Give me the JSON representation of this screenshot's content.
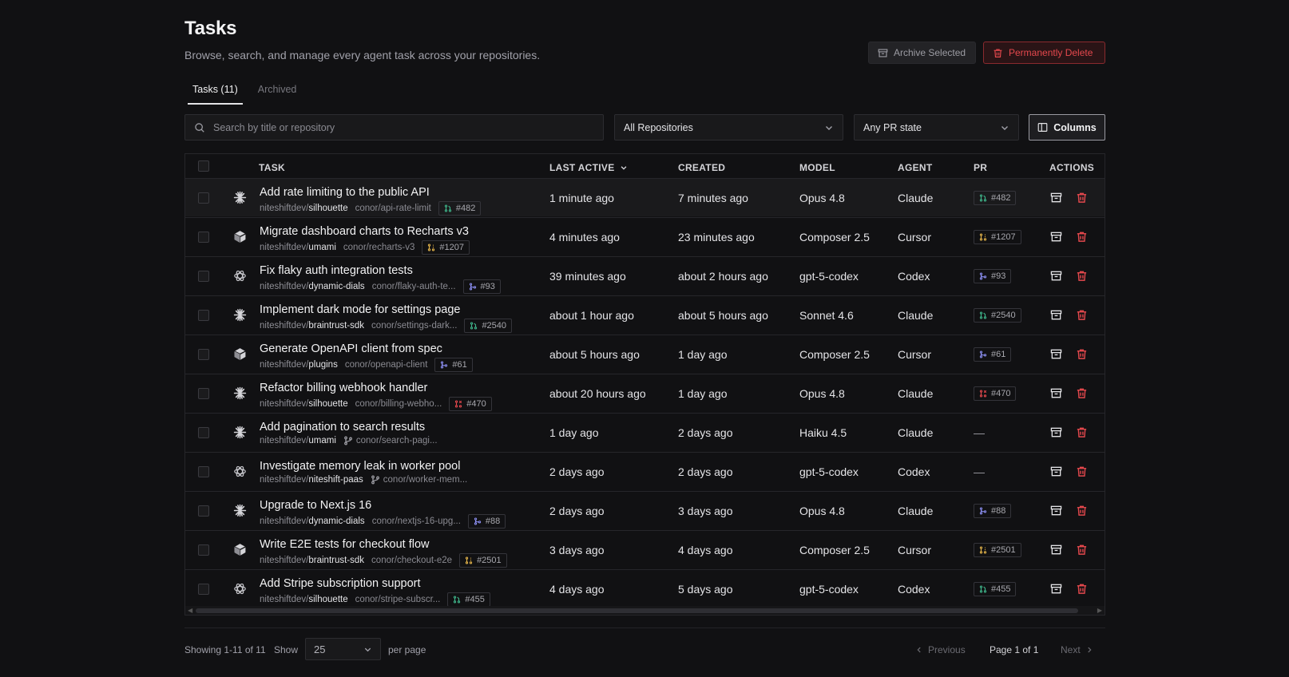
{
  "header": {
    "title": "Tasks",
    "subtitle": "Browse, search, and manage every agent task across your repositories.",
    "archive_selected": "Archive Selected",
    "permanently_delete": "Permanently Delete"
  },
  "tabs": [
    {
      "label": "Tasks (11)",
      "active": true
    },
    {
      "label": "Archived",
      "active": false
    }
  ],
  "filters": {
    "search_placeholder": "Search by title or repository",
    "search_value": "",
    "repository": "All Repositories",
    "pr_state": "Any PR state",
    "columns": "Columns"
  },
  "table": {
    "headers": {
      "task": "TASK",
      "last_active": "LAST ACTIVE",
      "created": "CREATED",
      "model": "MODEL",
      "agent": "AGENT",
      "pr": "PR",
      "actions": "ACTIONS"
    },
    "rows": [
      {
        "icon": "claude-icon",
        "title": "Add rate limiting to the public API",
        "owner": "niteshiftdev/",
        "repo": "silhouette",
        "branch": "conor/api-rate-limit",
        "pr": "#482",
        "pr_state": "open",
        "last_active": "1 minute ago",
        "created": "7 minutes ago",
        "model": "Opus 4.8",
        "agent": "Claude"
      },
      {
        "icon": "cursor-icon",
        "title": "Migrate dashboard charts to Recharts v3",
        "owner": "niteshiftdev/",
        "repo": "umami",
        "branch": "conor/recharts-v3",
        "pr": "#1207",
        "pr_state": "draft",
        "last_active": "4 minutes ago",
        "created": "23 minutes ago",
        "model": "Composer 2.5",
        "agent": "Cursor"
      },
      {
        "icon": "codex-icon",
        "title": "Fix flaky auth integration tests",
        "owner": "niteshiftdev/",
        "repo": "dynamic-dials",
        "branch": "conor/flaky-auth-te...",
        "pr": "#93",
        "pr_state": "merged",
        "last_active": "39 minutes ago",
        "created": "about 2 hours ago",
        "model": "gpt-5-codex",
        "agent": "Codex"
      },
      {
        "icon": "claude-icon",
        "title": "Implement dark mode for settings page",
        "owner": "niteshiftdev/",
        "repo": "braintrust-sdk",
        "branch": "conor/settings-dark...",
        "pr": "#2540",
        "pr_state": "open",
        "last_active": "about 1 hour ago",
        "created": "about 5 hours ago",
        "model": "Sonnet 4.6",
        "agent": "Claude"
      },
      {
        "icon": "cursor-icon",
        "title": "Generate OpenAPI client from spec",
        "owner": "niteshiftdev/",
        "repo": "plugins",
        "branch": "conor/openapi-client",
        "pr": "#61",
        "pr_state": "merged",
        "last_active": "about 5 hours ago",
        "created": "1 day ago",
        "model": "Composer 2.5",
        "agent": "Cursor"
      },
      {
        "icon": "claude-icon",
        "title": "Refactor billing webhook handler",
        "owner": "niteshiftdev/",
        "repo": "silhouette",
        "branch": "conor/billing-webho...",
        "pr": "#470",
        "pr_state": "closed",
        "last_active": "about 20 hours ago",
        "created": "1 day ago",
        "model": "Opus 4.8",
        "agent": "Claude"
      },
      {
        "icon": "claude-icon",
        "title": "Add pagination to search results",
        "owner": "niteshiftdev/",
        "repo": "umami",
        "branch": "conor/search-pagi...",
        "pr": "—",
        "pr_state": "none",
        "last_active": "1 day ago",
        "created": "2 days ago",
        "model": "Haiku 4.5",
        "agent": "Claude"
      },
      {
        "icon": "codex-icon",
        "title": "Investigate memory leak in worker pool",
        "owner": "niteshiftdev/",
        "repo": "niteshift-paas",
        "branch": "conor/worker-mem...",
        "pr": "—",
        "pr_state": "none",
        "last_active": "2 days ago",
        "created": "2 days ago",
        "model": "gpt-5-codex",
        "agent": "Codex"
      },
      {
        "icon": "claude-icon",
        "title": "Upgrade to Next.js 16",
        "owner": "niteshiftdev/",
        "repo": "dynamic-dials",
        "branch": "conor/nextjs-16-upg...",
        "pr": "#88",
        "pr_state": "merged",
        "last_active": "2 days ago",
        "created": "3 days ago",
        "model": "Opus 4.8",
        "agent": "Claude"
      },
      {
        "icon": "cursor-icon",
        "title": "Write E2E tests for checkout flow",
        "owner": "niteshiftdev/",
        "repo": "braintrust-sdk",
        "branch": "conor/checkout-e2e",
        "pr": "#2501",
        "pr_state": "draft",
        "last_active": "3 days ago",
        "created": "4 days ago",
        "model": "Composer 2.5",
        "agent": "Cursor"
      },
      {
        "icon": "codex-icon",
        "title": "Add Stripe subscription support",
        "owner": "niteshiftdev/",
        "repo": "silhouette",
        "branch": "conor/stripe-subscr...",
        "pr": "#455",
        "pr_state": "open",
        "last_active": "4 days ago",
        "created": "5 days ago",
        "model": "gpt-5-codex",
        "agent": "Codex"
      }
    ]
  },
  "pr_colors": {
    "open": "#3fb68b",
    "draft": "#e5b54a",
    "merged": "#8b8ef0",
    "closed": "#e5484d"
  },
  "footer": {
    "showing": "Showing 1-11 of 11",
    "show_label": "Show",
    "per_page_value": "25",
    "per_page_label": "per page",
    "previous": "Previous",
    "page_info": "Page 1 of 1",
    "next": "Next"
  }
}
